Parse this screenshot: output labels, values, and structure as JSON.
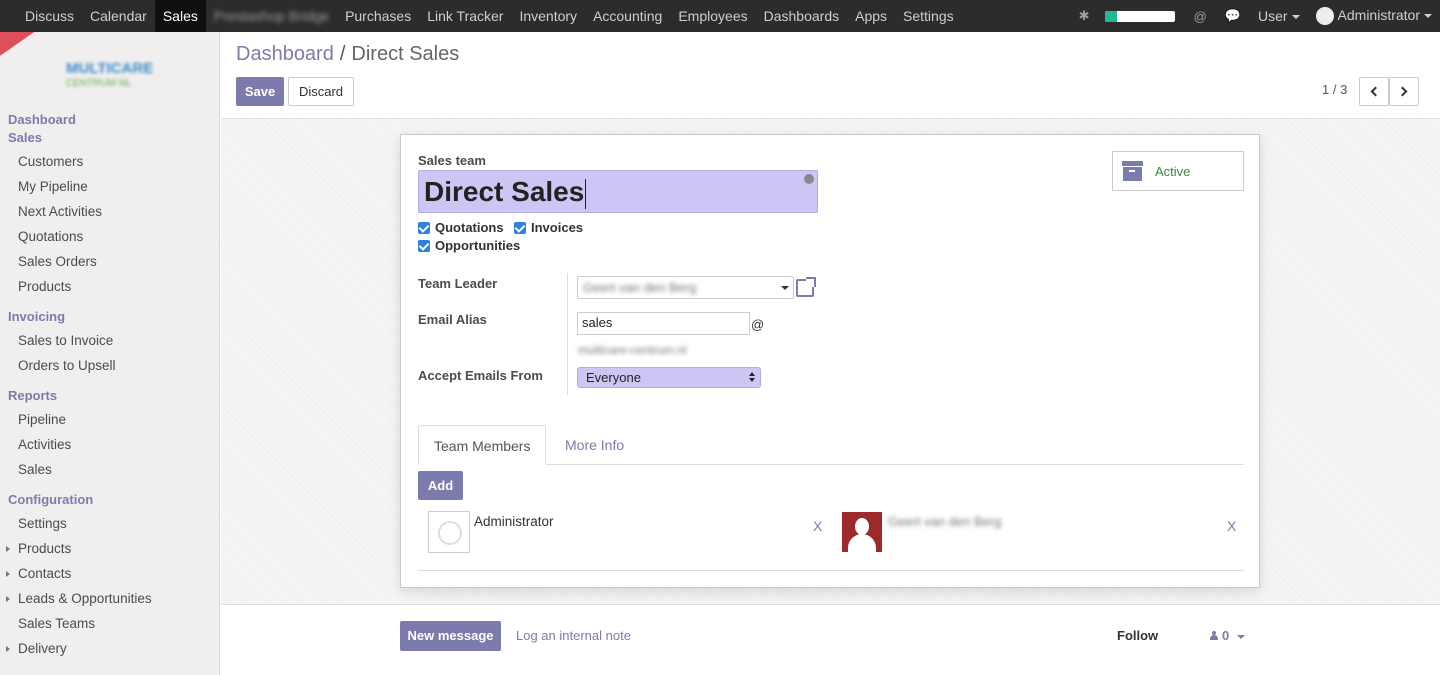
{
  "topbar": {
    "menus": [
      "Discuss",
      "Calendar",
      "Sales",
      "Prestashop Bridge",
      "Purchases",
      "Link Tracker",
      "Inventory",
      "Accounting",
      "Employees",
      "Dashboards",
      "Apps",
      "Settings"
    ],
    "active": "Sales",
    "user_label": "User",
    "admin_label": "Administrator",
    "progress": 0.18,
    "progress_color": "#21b799"
  },
  "sidebar": {
    "logo_text": "MULTICARE",
    "logo_sub": "CENTRUM NL",
    "dashboard_label": "Dashboard",
    "sales_section": "Sales",
    "sales_items": [
      "Customers",
      "My Pipeline",
      "Next Activities",
      "Quotations",
      "Sales Orders",
      "Products"
    ],
    "invoicing_section": "Invoicing",
    "invoicing_items": [
      "Sales to Invoice",
      "Orders to Upsell"
    ],
    "reports_section": "Reports",
    "reports_items": [
      "Pipeline",
      "Activities",
      "Sales"
    ],
    "config_section": "Configuration",
    "config_items": [
      "Settings",
      "Products",
      "Contacts",
      "Leads & Opportunities",
      "Sales Teams",
      "Delivery"
    ]
  },
  "breadcrumb": {
    "parent": "Dashboard",
    "separator": "/",
    "current": "Direct Sales"
  },
  "actions": {
    "save": "Save",
    "discard": "Discard"
  },
  "pager": {
    "text": "1 / 3"
  },
  "form": {
    "sales_team_label": "Sales team",
    "name": "Direct Sales",
    "checkboxes": {
      "quotations": "Quotations",
      "invoices": "Invoices",
      "opportunities": "Opportunities"
    },
    "active_label": "Active",
    "team_leader_label": "Team Leader",
    "team_leader_value": "Geert van den Berg",
    "email_alias_label": "Email Alias",
    "email_alias_value": "sales",
    "at_sign": "@",
    "alias_domain": "multicare-centrum.nl",
    "accept_emails_label": "Accept Emails From",
    "accept_emails_value": "Everyone",
    "tabs": [
      "Team Members",
      "More Info"
    ],
    "add_label": "Add",
    "members": [
      {
        "name": "Administrator",
        "remove": "X"
      },
      {
        "name": "Geert van den Berg",
        "remove": "X"
      }
    ]
  },
  "chatter": {
    "new_message": "New message",
    "log_note": "Log an internal note",
    "follow": "Follow",
    "followers_count": "0"
  },
  "colors": {
    "primary": "#7c7bad",
    "topbar": "#2c2c2c",
    "name_field": "#cdc6f5",
    "active_text": "#3b8a3b"
  }
}
